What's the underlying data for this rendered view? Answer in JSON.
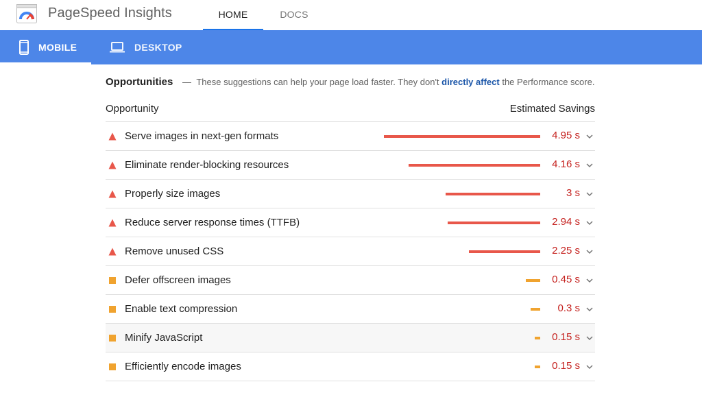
{
  "header": {
    "app_title": "PageSpeed Insights",
    "tabs": [
      {
        "label": "HOME",
        "active": true
      },
      {
        "label": "DOCS",
        "active": false
      }
    ]
  },
  "device_tabs": [
    {
      "label": "MOBILE",
      "icon": "phone-icon",
      "active": true
    },
    {
      "label": "DESKTOP",
      "icon": "laptop-icon",
      "active": false
    }
  ],
  "opportunities": {
    "heading": "Opportunities",
    "dash": "—",
    "desc_before": "These suggestions can help your page load faster. They don't",
    "link_text": "directly affect",
    "desc_after": "the Performance score.",
    "col_opportunity": "Opportunity",
    "col_savings": "Estimated Savings",
    "items": [
      {
        "label": "Serve images in next-gen formats",
        "savings": "4.95 s",
        "seconds": 4.95,
        "severity": "fail"
      },
      {
        "label": "Eliminate render-blocking resources",
        "savings": "4.16 s",
        "seconds": 4.16,
        "severity": "fail"
      },
      {
        "label": "Properly size images",
        "savings": "3 s",
        "seconds": 3.0,
        "severity": "fail"
      },
      {
        "label": "Reduce server response times (TTFB)",
        "savings": "2.94 s",
        "seconds": 2.94,
        "severity": "fail"
      },
      {
        "label": "Remove unused CSS",
        "savings": "2.25 s",
        "seconds": 2.25,
        "severity": "fail"
      },
      {
        "label": "Defer offscreen images",
        "savings": "0.45 s",
        "seconds": 0.45,
        "severity": "average"
      },
      {
        "label": "Enable text compression",
        "savings": "0.3 s",
        "seconds": 0.3,
        "severity": "average"
      },
      {
        "label": "Minify JavaScript",
        "savings": "0.15 s",
        "seconds": 0.15,
        "severity": "average"
      },
      {
        "label": "Efficiently encode images",
        "savings": "0.15 s",
        "seconds": 0.15,
        "severity": "average"
      }
    ]
  },
  "colors": {
    "fail": "#e8574a",
    "average": "#f0a32f",
    "fail_text": "#c5221f",
    "average_text": "#c5221f",
    "device_bar": "#4d86e8",
    "link": "#1a55a8"
  }
}
